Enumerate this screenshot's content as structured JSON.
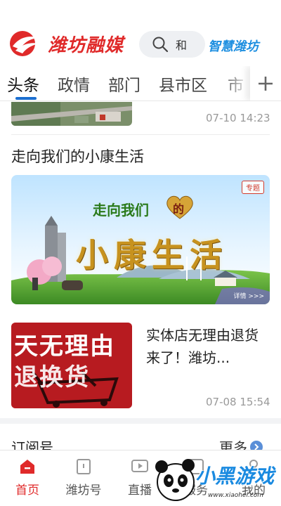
{
  "header": {
    "logo_text": "潍坊融媒",
    "search_text": "和",
    "brand_right": "智慧潍坊"
  },
  "tabs": [
    {
      "label": "头条",
      "active": true
    },
    {
      "label": "政情",
      "active": false
    },
    {
      "label": "部门",
      "active": false
    },
    {
      "label": "县市区",
      "active": false
    },
    {
      "label": "市",
      "active": false
    }
  ],
  "feed": {
    "item1_time": "07-10 14:23",
    "section_title": "走向我们的小康生活",
    "banner": {
      "tag": "专题",
      "heading": "走向我们",
      "heart_char": "的",
      "main": "小康生活",
      "small": "详情 >>>"
    },
    "item2": {
      "title": "实体店无理由退货来了！潍坊...",
      "time": "07-08 15:54",
      "thumb_lines": [
        "天无理由",
        "退换货"
      ]
    },
    "subscribe_label": "订阅号",
    "more_label": "更多"
  },
  "bottom_nav": [
    {
      "label": "首页",
      "icon": "home-icon",
      "active": true
    },
    {
      "label": "潍坊号",
      "icon": "bookmark-icon",
      "active": false
    },
    {
      "label": "直播",
      "icon": "video-icon",
      "active": false
    },
    {
      "label": "服务",
      "icon": "service-icon",
      "active": false
    },
    {
      "label": "我的",
      "icon": "user-icon",
      "active": false
    }
  ],
  "watermark": {
    "text": "小黑游戏",
    "url": "www.xiaohei.com"
  },
  "colors": {
    "brand_red": "#e02a2a",
    "accent_blue": "#1c6fd1",
    "meta_gray": "#999999"
  }
}
